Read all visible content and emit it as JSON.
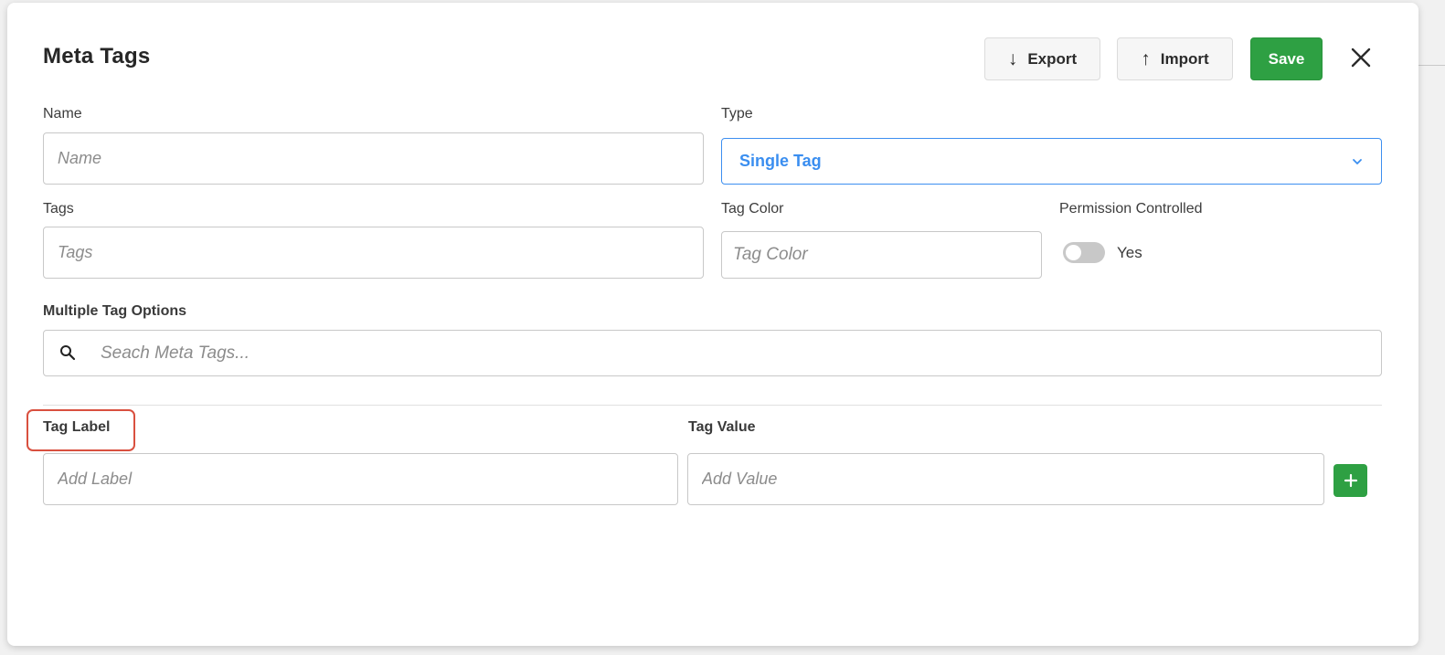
{
  "modal": {
    "title": "Meta Tags",
    "export_label": "Export",
    "import_label": "Import",
    "save_label": "Save"
  },
  "form": {
    "name": {
      "label": "Name",
      "placeholder": "Name",
      "value": ""
    },
    "type": {
      "label": "Type",
      "selected": "Single Tag"
    },
    "tags": {
      "label": "Tags",
      "placeholder": "Tags",
      "value": ""
    },
    "tag_color": {
      "label": "Tag Color",
      "placeholder": "Tag Color",
      "value": ""
    },
    "permission": {
      "label": "Permission Controlled",
      "toggle_label": "Yes",
      "enabled": false
    },
    "multiple_tag_options": {
      "label": "Multiple Tag Options",
      "placeholder": "Seach Meta Tags..."
    },
    "tag_label": {
      "label": "Tag Label",
      "placeholder": "Add Label"
    },
    "tag_value": {
      "label": "Tag Value",
      "placeholder": "Add Value"
    }
  },
  "colors": {
    "primary_green": "#2ea043",
    "select_blue": "#3a8ef0",
    "highlight_red": "#d9503f"
  },
  "icons": {
    "export": "arrow-down-icon",
    "import": "arrow-up-icon",
    "close": "close-icon",
    "chevron": "chevron-down-icon",
    "search": "search-icon",
    "add": "plus-icon"
  }
}
